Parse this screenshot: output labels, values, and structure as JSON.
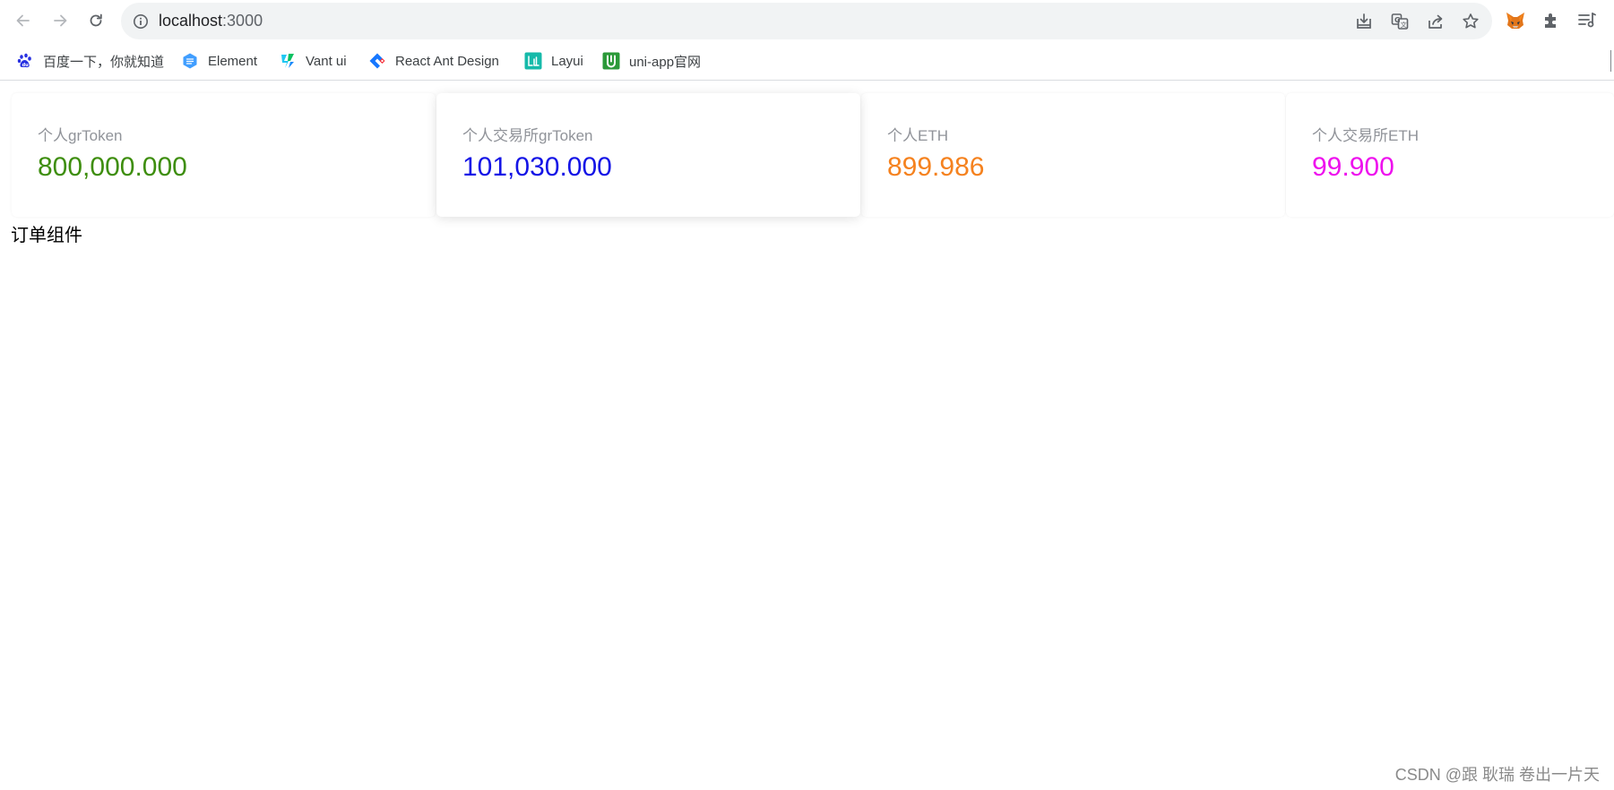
{
  "browser": {
    "url_host": "localhost",
    "url_port": ":3000",
    "icons": {
      "back": "arrow-left-icon",
      "forward": "arrow-right-icon",
      "reload": "reload-icon",
      "site_info": "info-icon",
      "install": "install-icon",
      "translate": "translate-icon",
      "share": "share-icon",
      "bookmark": "star-icon",
      "metamask": "fox-icon",
      "extensions": "puzzle-icon",
      "reading_list": "reading-list-icon"
    }
  },
  "bookmarks": [
    {
      "label": "百度一下，你就知道",
      "icon": "paw-icon"
    },
    {
      "label": "Element",
      "icon": "element-icon"
    },
    {
      "label": "Vant ui",
      "icon": "vant-icon"
    },
    {
      "label": "React Ant Design",
      "icon": "ant-design-icon"
    },
    {
      "label": "Layui",
      "icon": "layui-icon"
    },
    {
      "label": "uni-app官网",
      "icon": "uniapp-icon"
    }
  ],
  "stats": [
    {
      "title": "个人grToken",
      "value": "800,000.000",
      "color": "#3e8e0e"
    },
    {
      "title": "个人交易所grToken",
      "value": "101,030.000",
      "color": "#1414e6"
    },
    {
      "title": "个人ETH",
      "value": "899.986",
      "color": "#f5821f"
    },
    {
      "title": "个人交易所ETH",
      "value": "99.900",
      "color": "#ee11ee"
    }
  ],
  "section_label": "订单组件",
  "watermark": "CSDN @跟 耿瑞 卷出一片天"
}
